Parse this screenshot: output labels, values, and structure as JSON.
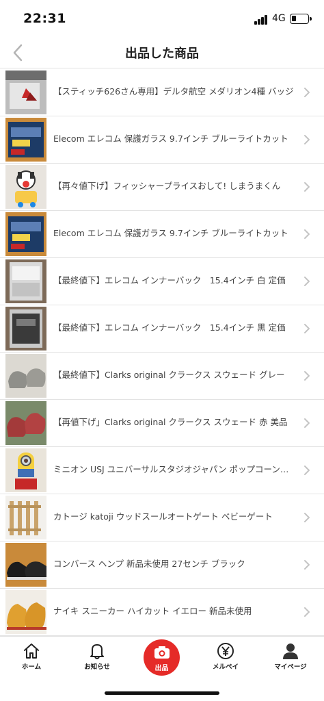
{
  "status_bar": {
    "time": "22:31",
    "network": "4G"
  },
  "nav": {
    "title": "出品した商品"
  },
  "items": [
    {
      "title": "【スティッチ626さん専用】デルタ航空 メダリオン4種 バッジ",
      "thumb": "card"
    },
    {
      "title": "Elecom エレコム 保護ガラス 9.7インチ ブルーライトカット",
      "thumb": "glass-box"
    },
    {
      "title": "【再々値下げ】フィッシャープライスおして! しまうまくん",
      "thumb": "toy"
    },
    {
      "title": "Elecom エレコム 保護ガラス 9.7インチ ブルーライトカット",
      "thumb": "glass-box"
    },
    {
      "title": "【最終値下】エレコム インナーバック　15.4インチ 白 定価",
      "thumb": "bag-white"
    },
    {
      "title": "【最終値下】エレコム インナーバック　15.4インチ 黒 定価",
      "thumb": "bag-black"
    },
    {
      "title": "【最終値下】Clarks original クラークス スウェード グレー",
      "thumb": "shoes-gray"
    },
    {
      "title": "【再値下げ」Clarks original クラークス スウェード 赤 美品",
      "thumb": "shoes-red"
    },
    {
      "title": "ミニオン USJ ユニバーサルスタジオジャパン ポップコーンバケツ",
      "thumb": "minion"
    },
    {
      "title": "カトージ katoji ウッドスールオートゲート ベビーゲート",
      "thumb": "gate"
    },
    {
      "title": "コンバース ヘンプ 新品未使用 27センチ ブラック",
      "thumb": "converse"
    },
    {
      "title": "ナイキ スニーカー ハイカット イエロー 新品未使用",
      "thumb": "nike"
    }
  ],
  "tabs": {
    "home": "ホーム",
    "notifications": "お知らせ",
    "sell": "出品",
    "merpay": "メルペイ",
    "mypage": "マイページ"
  },
  "colors": {
    "accent": "#e52b28"
  }
}
